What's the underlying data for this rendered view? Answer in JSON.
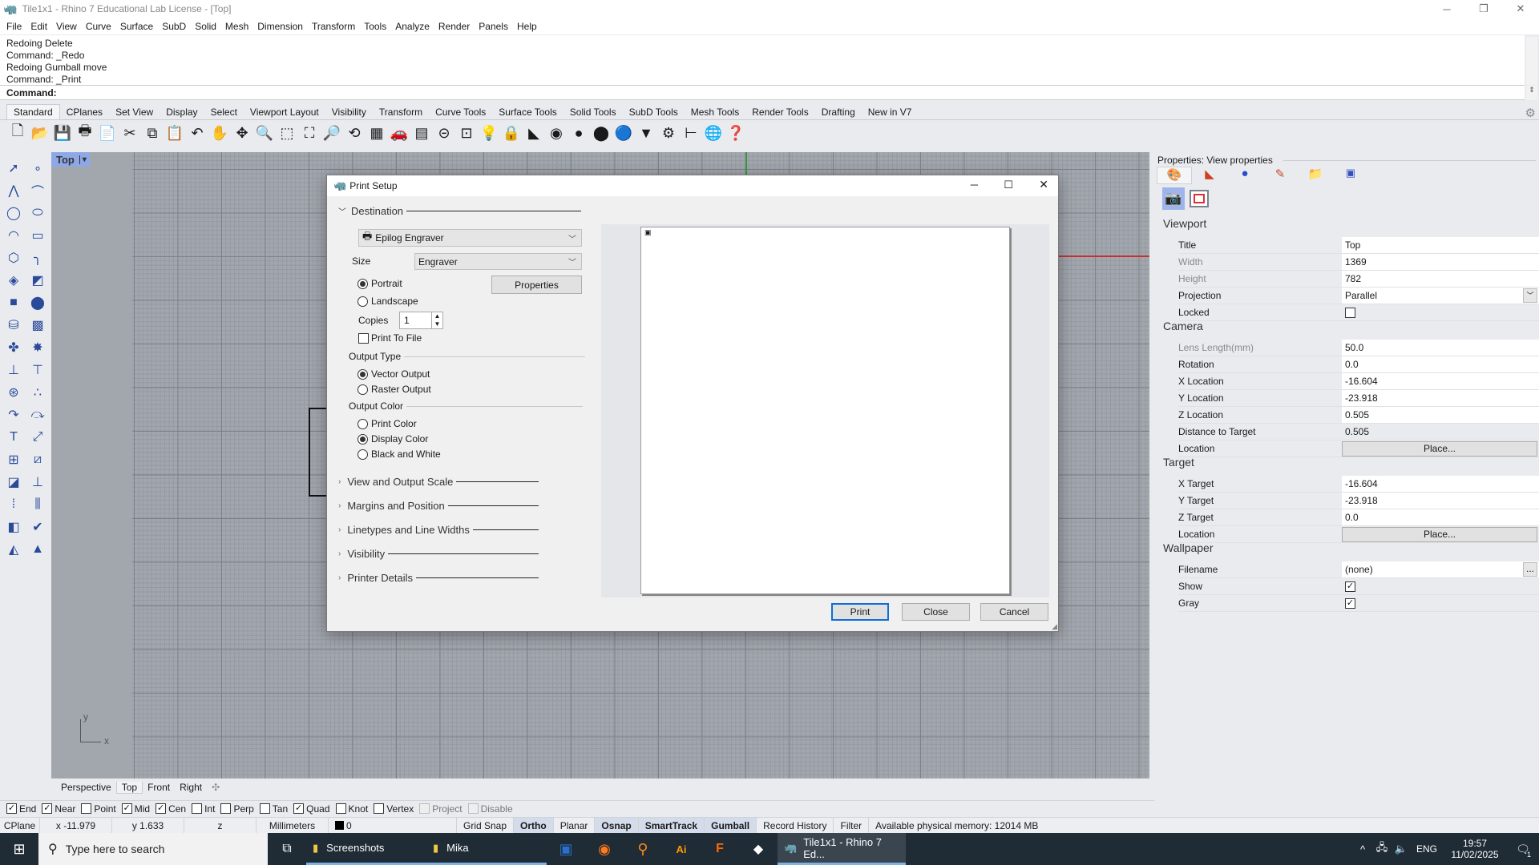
{
  "window": {
    "title": "Tile1x1 - Rhino 7 Educational Lab License - [Top]",
    "min": "─",
    "max": "❐",
    "close": "✕"
  },
  "menu": [
    "File",
    "Edit",
    "View",
    "Curve",
    "Surface",
    "SubD",
    "Solid",
    "Mesh",
    "Dimension",
    "Transform",
    "Tools",
    "Analyze",
    "Render",
    "Panels",
    "Help"
  ],
  "command": {
    "history": [
      "Redoing Delete",
      "Command: _Redo",
      "Redoing Gumball move",
      "Command: _Print"
    ],
    "prompt": "Command:"
  },
  "toolbar_tabs": {
    "active": "Standard",
    "items": [
      "Standard",
      "CPlanes",
      "Set View",
      "Display",
      "Select",
      "Viewport Layout",
      "Visibility",
      "Transform",
      "Curve Tools",
      "Surface Tools",
      "Solid Tools",
      "SubD Tools",
      "Mesh Tools",
      "Render Tools",
      "Drafting",
      "New in V7"
    ]
  },
  "toolbar_icons": [
    {
      "name": "new-file",
      "glyph": "🗋"
    },
    {
      "name": "open-folder",
      "glyph": "📂"
    },
    {
      "name": "save",
      "glyph": "💾"
    },
    {
      "name": "print",
      "glyph": "🖶"
    },
    {
      "name": "import",
      "glyph": "📄"
    },
    {
      "name": "cut",
      "glyph": "✂"
    },
    {
      "name": "copy",
      "glyph": "⧉"
    },
    {
      "name": "paste",
      "glyph": "📋"
    },
    {
      "name": "undo",
      "glyph": "↶"
    },
    {
      "name": "pan-hand",
      "glyph": "✋"
    },
    {
      "name": "rotate-view",
      "glyph": "✥"
    },
    {
      "name": "zoom-dynamic",
      "glyph": "🔍"
    },
    {
      "name": "zoom-window",
      "glyph": "⬚"
    },
    {
      "name": "zoom-extents",
      "glyph": "⛶"
    },
    {
      "name": "zoom-selected",
      "glyph": "🔎"
    },
    {
      "name": "undo-view",
      "glyph": "⟲"
    },
    {
      "name": "four-viewports",
      "glyph": "▦"
    },
    {
      "name": "car-named-view",
      "glyph": "🚗"
    },
    {
      "name": "grid-settings",
      "glyph": "▤"
    },
    {
      "name": "cplane",
      "glyph": "⊝"
    },
    {
      "name": "object-snap",
      "glyph": "⊡"
    },
    {
      "name": "lightbulb",
      "glyph": "💡"
    },
    {
      "name": "lock",
      "glyph": "🔒"
    },
    {
      "name": "layer",
      "glyph": "◣"
    },
    {
      "name": "color-wheel",
      "glyph": "◉"
    },
    {
      "name": "shaded-sphere",
      "glyph": "●"
    },
    {
      "name": "rendered-sphere",
      "glyph": "⬤"
    },
    {
      "name": "blue-sphere",
      "glyph": "🔵"
    },
    {
      "name": "render-cone",
      "glyph": "▼"
    },
    {
      "name": "options-gear",
      "glyph": "⚙"
    },
    {
      "name": "dimension",
      "glyph": "⊢"
    },
    {
      "name": "globe",
      "glyph": "🌐"
    },
    {
      "name": "help",
      "glyph": "❓"
    }
  ],
  "left_toolbar": [
    {
      "name": "select-arrow",
      "glyph": "➚"
    },
    {
      "name": "point",
      "glyph": "∘"
    },
    {
      "name": "polyline",
      "glyph": "⋀"
    },
    {
      "name": "curve-cv",
      "glyph": "⌒"
    },
    {
      "name": "circle",
      "glyph": "◯"
    },
    {
      "name": "ellipse",
      "glyph": "⬭"
    },
    {
      "name": "arc",
      "glyph": "◠"
    },
    {
      "name": "rectangle",
      "glyph": "▭"
    },
    {
      "name": "polygon",
      "glyph": "⬡"
    },
    {
      "name": "fillet",
      "glyph": "╮"
    },
    {
      "name": "surface-points",
      "glyph": "◈"
    },
    {
      "name": "extrude-surface",
      "glyph": "◩"
    },
    {
      "name": "box",
      "glyph": "■"
    },
    {
      "name": "boolean-spheres",
      "glyph": "⬤"
    },
    {
      "name": "cylinder",
      "glyph": "⛁"
    },
    {
      "name": "mesh",
      "glyph": "▩"
    },
    {
      "name": "puzzle-join",
      "glyph": "✤"
    },
    {
      "name": "explode",
      "glyph": "✸"
    },
    {
      "name": "trim",
      "glyph": "⊥"
    },
    {
      "name": "split",
      "glyph": "⊤"
    },
    {
      "name": "group-objects",
      "glyph": "⊛"
    },
    {
      "name": "ungroup",
      "glyph": "∴"
    },
    {
      "name": "rebuild-curve",
      "glyph": "↷"
    },
    {
      "name": "offset-curve",
      "glyph": "⤼"
    },
    {
      "name": "text",
      "glyph": "T"
    },
    {
      "name": "scale",
      "glyph": "⤢"
    },
    {
      "name": "array",
      "glyph": "⊞"
    },
    {
      "name": "align",
      "glyph": "⧄"
    },
    {
      "name": "solid-edit",
      "glyph": "◪"
    },
    {
      "name": "dimension-tool",
      "glyph": "⊥"
    },
    {
      "name": "grid-array",
      "glyph": "⁞"
    },
    {
      "name": "section",
      "glyph": "⫼"
    },
    {
      "name": "analyze",
      "glyph": "◧"
    },
    {
      "name": "check",
      "glyph": "✔"
    },
    {
      "name": "render-shapes",
      "glyph": "◭"
    },
    {
      "name": "pyramid",
      "glyph": "▲"
    }
  ],
  "viewport": {
    "label": "Top",
    "axis_x": "x",
    "axis_y": "y",
    "tabs": [
      "Perspective",
      "Top",
      "Front",
      "Right"
    ],
    "active_tab": "Top",
    "colors": {
      "background": "#a2a6ad",
      "x_axis": "#c8302f",
      "y_axis": "#2f9a3a"
    }
  },
  "osnap": [
    {
      "label": "End",
      "checked": true
    },
    {
      "label": "Near",
      "checked": true
    },
    {
      "label": "Point",
      "checked": false
    },
    {
      "label": "Mid",
      "checked": true
    },
    {
      "label": "Cen",
      "checked": true
    },
    {
      "label": "Int",
      "checked": false
    },
    {
      "label": "Perp",
      "checked": false
    },
    {
      "label": "Tan",
      "checked": false
    },
    {
      "label": "Quad",
      "checked": true
    },
    {
      "label": "Knot",
      "checked": false
    },
    {
      "label": "Vertex",
      "checked": false
    },
    {
      "label": "Project",
      "checked": false,
      "disabled": true
    },
    {
      "label": "Disable",
      "checked": false,
      "disabled": true
    }
  ],
  "status": {
    "cplane": "CPlane",
    "x": "x -11.979",
    "y": "y 1.633",
    "z": "z",
    "units": "Millimeters",
    "layer": "0",
    "toggles": [
      {
        "label": "Grid Snap",
        "on": false
      },
      {
        "label": "Ortho",
        "on": true
      },
      {
        "label": "Planar",
        "on": false
      },
      {
        "label": "Osnap",
        "on": true
      },
      {
        "label": "SmartTrack",
        "on": true
      },
      {
        "label": "Gumball",
        "on": true
      },
      {
        "label": "Record History",
        "on": false
      },
      {
        "label": "Filter",
        "on": false
      }
    ],
    "memory": "Available physical memory: 12014 MB"
  },
  "properties": {
    "title": "Properties: View properties",
    "sections": [
      {
        "title": "Viewport",
        "rows": [
          {
            "label": "Title",
            "value": "Top"
          },
          {
            "label": "Width",
            "value": "1369",
            "dim": true
          },
          {
            "label": "Height",
            "value": "782",
            "dim": true
          },
          {
            "label": "Projection",
            "value": "Parallel",
            "dropdown": true
          },
          {
            "label": "Locked",
            "checkbox": false
          }
        ]
      },
      {
        "title": "Camera",
        "rows": [
          {
            "label": "Lens Length(mm)",
            "value": "50.0",
            "dim": true
          },
          {
            "label": "Rotation",
            "value": "0.0"
          },
          {
            "label": "X Location",
            "value": "-16.604"
          },
          {
            "label": "Y Location",
            "value": "-23.918"
          },
          {
            "label": "Z Location",
            "value": "0.505"
          },
          {
            "label": "Distance to Target",
            "value": "0.505",
            "readonly": true
          },
          {
            "label": "Location",
            "button": "Place..."
          }
        ]
      },
      {
        "title": "Target",
        "rows": [
          {
            "label": "X Target",
            "value": "-16.604"
          },
          {
            "label": "Y Target",
            "value": "-23.918"
          },
          {
            "label": "Z Target",
            "value": "0.0"
          },
          {
            "label": "Location",
            "button": "Place..."
          }
        ]
      },
      {
        "title": "Wallpaper",
        "rows": [
          {
            "label": "Filename",
            "value": "(none)",
            "browse": "..."
          },
          {
            "label": "Show",
            "checkbox": true
          },
          {
            "label": "Gray",
            "checkbox": true
          }
        ]
      }
    ]
  },
  "dialog": {
    "title": "Print Setup",
    "destination": {
      "header": "Destination",
      "printer": "Epilog Engraver",
      "size_label": "Size",
      "size": "Engraver",
      "orientation": [
        {
          "label": "Portrait",
          "selected": true
        },
        {
          "label": "Landscape",
          "selected": false
        }
      ],
      "properties_button": "Properties",
      "copies_label": "Copies",
      "copies": "1",
      "print_to_file": {
        "label": "Print To File",
        "checked": false
      }
    },
    "output_type": {
      "header": "Output Type",
      "options": [
        {
          "label": "Vector Output",
          "selected": true
        },
        {
          "label": "Raster Output",
          "selected": false
        }
      ]
    },
    "output_color": {
      "header": "Output Color",
      "options": [
        {
          "label": "Print Color",
          "selected": false
        },
        {
          "label": "Display Color",
          "selected": true
        },
        {
          "label": "Black and White",
          "selected": false
        }
      ]
    },
    "collapsed": [
      "View and Output Scale",
      "Margins and Position",
      "Linetypes and Line Widths",
      "Visibility",
      "Printer Details"
    ],
    "buttons": {
      "print": "Print",
      "close": "Close",
      "cancel": "Cancel"
    }
  },
  "taskbar": {
    "search_placeholder": "Type here to search",
    "items": [
      "Screenshots",
      "Mika"
    ],
    "active_app": "Tile1x1 - Rhino 7 Ed...",
    "language": "ENG",
    "time": "19:57",
    "date": "11/02/2025",
    "notifications": "1"
  }
}
